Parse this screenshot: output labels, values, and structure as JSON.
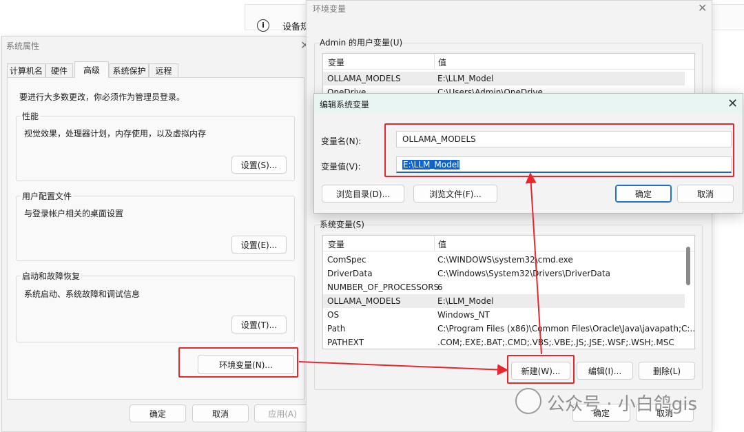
{
  "background": {
    "device_label": "设备规"
  },
  "system_properties": {
    "title": "系统属性",
    "tabs": [
      "计算机名",
      "硬件",
      "高级",
      "系统保护",
      "远程"
    ],
    "active_tab": "高级",
    "admin_note": "要进行大多数更改，你必须作为管理员登录。",
    "performance": {
      "title": "性能",
      "description": "视觉效果，处理器计划，内存使用，以及虚拟内存",
      "button": "设置(S)..."
    },
    "user_profiles": {
      "title": "用户配置文件",
      "description": "与登录帐户相关的桌面设置",
      "button": "设置(E)..."
    },
    "startup_recovery": {
      "title": "启动和故障恢复",
      "description": "系统启动、系统故障和调试信息",
      "button": "设置(T)..."
    },
    "env_button": "环境变量(N)...",
    "ok": "确定",
    "cancel": "取消",
    "apply": "应用(A)"
  },
  "env_vars": {
    "title": "环境变量",
    "user_section": "Admin 的用户变量(U)",
    "columns": [
      "变量",
      "值"
    ],
    "user_rows": [
      {
        "name": "OLLAMA_MODELS",
        "value": "E:\\LLM_Model"
      },
      {
        "name": "OneDrive",
        "value": "C:\\Users\\Admin\\OneDrive"
      }
    ],
    "system_section": "系统变量(S)",
    "system_rows": [
      {
        "name": "ComSpec",
        "value": "C:\\WINDOWS\\system32\\cmd.exe"
      },
      {
        "name": "DriverData",
        "value": "C:\\Windows\\System32\\Drivers\\DriverData"
      },
      {
        "name": "NUMBER_OF_PROCESSORS",
        "value": "6"
      },
      {
        "name": "OLLAMA_MODELS",
        "value": "E:\\LLM_Model"
      },
      {
        "name": "OS",
        "value": "Windows_NT"
      },
      {
        "name": "Path",
        "value": "C:\\Program Files (x86)\\Common Files\\Oracle\\Java\\javapath;C:..."
      },
      {
        "name": "PATHEXT",
        "value": ".COM;.EXE;.BAT;.CMD;.VBS;.VBE;.JS;.JSE;.WSF;.WSH;.MSC"
      }
    ],
    "selected_system_row": "OLLAMA_MODELS",
    "new_button": "新建(W)...",
    "edit_button": "编辑(I)...",
    "delete_button": "删除(L)",
    "ok": "确定",
    "cancel": "取消"
  },
  "edit_dialog": {
    "title": "编辑系统变量",
    "name_label": "变量名(N):",
    "name_value": "OLLAMA_MODELS",
    "value_label": "变量值(V):",
    "value_value": "E:\\LLM_Model",
    "browse_dir": "浏览目录(D)...",
    "browse_file": "浏览文件(F)...",
    "ok": "确定",
    "cancel": "取消"
  },
  "watermark": "公众号 · 小白鸽gis",
  "colors": {
    "highlight_red": "#e8262b",
    "accent_blue": "#1a73c9",
    "selection_blue": "#0a64d6"
  }
}
